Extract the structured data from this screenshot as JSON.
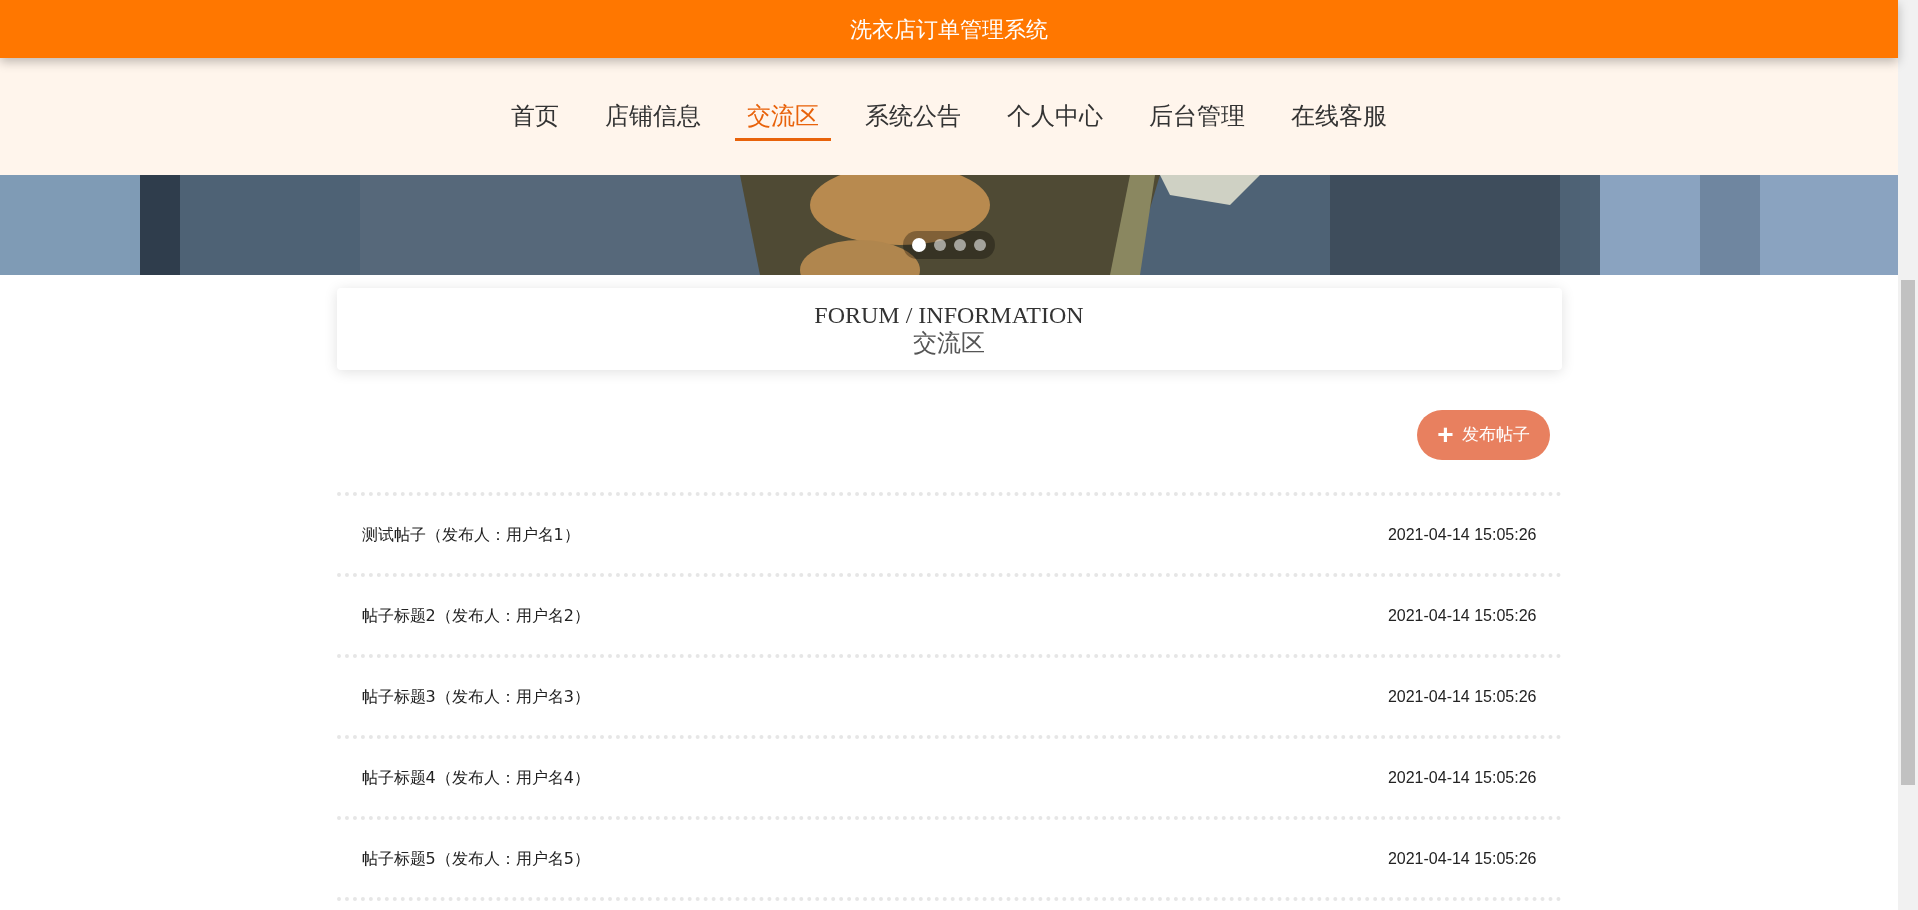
{
  "header": {
    "title": "洗衣店订单管理系统"
  },
  "nav": [
    {
      "label": "首页",
      "selected": false
    },
    {
      "label": "店铺信息",
      "selected": false
    },
    {
      "label": "交流区",
      "selected": true
    },
    {
      "label": "系统公告",
      "selected": false
    },
    {
      "label": "个人中心",
      "selected": false
    },
    {
      "label": "后台管理",
      "selected": false
    },
    {
      "label": "在线客服",
      "selected": false
    }
  ],
  "banner": {
    "slides": [
      {
        "selected": true
      },
      {
        "selected": false
      },
      {
        "selected": false
      },
      {
        "selected": false
      }
    ]
  },
  "section": {
    "title_en": "FORUM / INFORMATION",
    "title": "交流区"
  },
  "add_button": {
    "icon": "+",
    "label": "发布帖子"
  },
  "posts": [
    {
      "title": "测试帖子（发布人：用户名1）",
      "time": "2021-04-14 15:05:26"
    },
    {
      "title": "帖子标题2（发布人：用户名2）",
      "time": "2021-04-14 15:05:26"
    },
    {
      "title": "帖子标题3（发布人：用户名3）",
      "time": "2021-04-14 15:05:26"
    },
    {
      "title": "帖子标题4（发布人：用户名4）",
      "time": "2021-04-14 15:05:26"
    },
    {
      "title": "帖子标题5（发布人：用户名5）",
      "time": "2021-04-14 15:05:26"
    }
  ]
}
